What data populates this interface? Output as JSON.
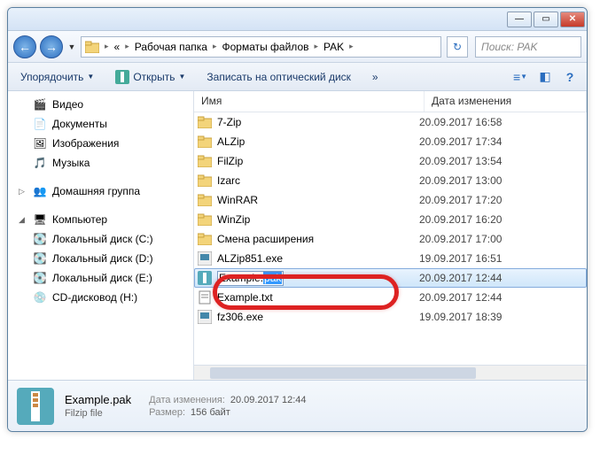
{
  "titlebar": {
    "min": "—",
    "max": "▭",
    "close": "✕"
  },
  "nav": {
    "back": "←",
    "fwd": "→",
    "breadcrumb": [
      "Рабочая папка",
      "Форматы файлов",
      "PAK"
    ],
    "refresh": "↻",
    "search_placeholder": "Поиск: PAK"
  },
  "toolbar": {
    "organize": "Упорядочить",
    "open": "Открыть",
    "burn": "Записать на оптический диск",
    "more": "»"
  },
  "sidebar": {
    "libs": [
      {
        "icon": "video",
        "label": "Видео"
      },
      {
        "icon": "doc",
        "label": "Документы"
      },
      {
        "icon": "img",
        "label": "Изображения"
      },
      {
        "icon": "music",
        "label": "Музыка"
      }
    ],
    "homegroup": {
      "icon": "homegroup",
      "label": "Домашняя группа"
    },
    "computer": {
      "icon": "computer",
      "label": "Компьютер",
      "drives": [
        {
          "icon": "drive",
          "label": "Локальный диск (C:)"
        },
        {
          "icon": "drive",
          "label": "Локальный диск (D:)"
        },
        {
          "icon": "drive",
          "label": "Локальный диск (E:)"
        },
        {
          "icon": "cd",
          "label": "CD-дисковод (H:)"
        }
      ]
    }
  },
  "columns": {
    "name": "Имя",
    "date": "Дата изменения"
  },
  "files": [
    {
      "type": "folder",
      "name": "7-Zip",
      "date": "20.09.2017 16:58"
    },
    {
      "type": "folder",
      "name": "ALZip",
      "date": "20.09.2017 17:34"
    },
    {
      "type": "folder",
      "name": "FilZip",
      "date": "20.09.2017 13:54"
    },
    {
      "type": "folder",
      "name": "Izarc",
      "date": "20.09.2017 13:00"
    },
    {
      "type": "folder",
      "name": "WinRAR",
      "date": "20.09.2017 17:20"
    },
    {
      "type": "folder",
      "name": "WinZip",
      "date": "20.09.2017 16:20"
    },
    {
      "type": "folder",
      "name": "Смена расширения",
      "date": "20.09.2017 17:00"
    },
    {
      "type": "exe",
      "name": "ALZip851.exe",
      "date": "19.09.2017 16:51"
    },
    {
      "type": "pak",
      "name": "Example.pak",
      "date": "20.09.2017 12:44",
      "editing": true,
      "base": "Example.",
      "sel": "pak"
    },
    {
      "type": "txt",
      "name": "Example.txt",
      "date": "20.09.2017 12:44"
    },
    {
      "type": "exe",
      "name": "fz306.exe",
      "date": "19.09.2017 18:39"
    }
  ],
  "details": {
    "name": "Example.pak",
    "type": "Filzip file",
    "date_label": "Дата изменения:",
    "date_value": "20.09.2017 12:44",
    "size_label": "Размер:",
    "size_value": "156 байт"
  }
}
